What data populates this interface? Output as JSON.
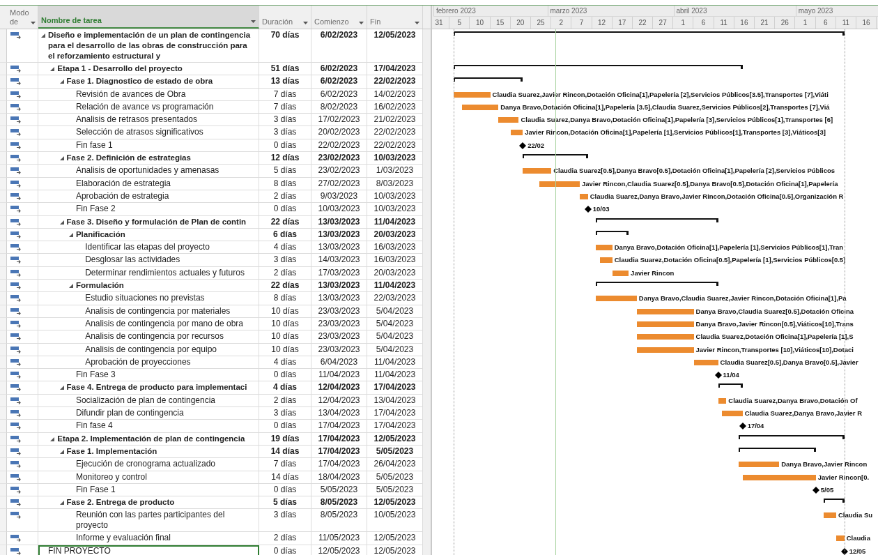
{
  "columns": [
    {
      "label": "Modo de",
      "selected": false
    },
    {
      "label": "Nombre de tarea",
      "selected": true
    },
    {
      "label": "Duración",
      "selected": false
    },
    {
      "label": "Comienzo",
      "selected": false
    },
    {
      "label": "Fin",
      "selected": false
    }
  ],
  "timescale": {
    "months": [
      "febrero 2023",
      "marzo 2023",
      "abril 2023",
      "mayo 2023"
    ],
    "days": [
      "31",
      "5",
      "10",
      "15",
      "20",
      "25",
      "2",
      "7",
      "12",
      "17",
      "22",
      "27",
      "1",
      "6",
      "11",
      "16",
      "21",
      "26",
      "1",
      "6",
      "11",
      "16"
    ]
  },
  "tasks": [
    {
      "name": "Diseño e implementación de un plan de contingencia para el desarrollo de las obras de construcción para el reforzamiento estructural y",
      "duration": "70 días",
      "start": "6/02/2023",
      "finish": "12/05/2023",
      "kind": "summary",
      "expanded": true,
      "selected": false,
      "children": [
        {
          "name": "Etapa 1 - Desarrollo del proyecto",
          "duration": "51 días",
          "start": "6/02/2023",
          "finish": "17/04/2023",
          "kind": "summary",
          "expanded": true,
          "selected": false,
          "children": [
            {
              "name": "Fase 1. Diagnostico de estado de obra",
              "duration": "13 días",
              "start": "6/02/2023",
              "finish": "22/02/2023",
              "kind": "summary",
              "expanded": true,
              "selected": false,
              "children": [
                {
                  "name": "Revisión de avances de Obra",
                  "duration": "7 días",
                  "start": "6/02/2023",
                  "finish": "14/02/2023",
                  "kind": "task",
                  "selected": false,
                  "label": "Claudia Suarez,Javier Rincon,Dotación Oficina[1],Papelería [2],Servicios Públicos[3.5],Transportes [7],Viáti"
                },
                {
                  "name": "Relación de avance vs programación",
                  "duration": "7 días",
                  "start": "8/02/2023",
                  "finish": "16/02/2023",
                  "kind": "task",
                  "selected": false,
                  "label": "Danya Bravo,Dotación Oficina[1],Papelería [3.5],Claudia Suarez,Servicios Públicos[2],Transportes [7],Viá"
                },
                {
                  "name": "Analisis de retrasos presentados",
                  "duration": "3 días",
                  "start": "17/02/2023",
                  "finish": "21/02/2023",
                  "kind": "task",
                  "selected": false,
                  "label": "Claudia Suarez,Danya Bravo,Dotación Oficina[1],Papelería [3],Servicios Públicos[1],Transportes [6]"
                },
                {
                  "name": "Selección de atrasos significativos",
                  "duration": "3 días",
                  "start": "20/02/2023",
                  "finish": "22/02/2023",
                  "kind": "task",
                  "selected": false,
                  "label": "Javier Rincon,Dotación Oficina[1],Papelería [1],Servicios Públicos[1],Transportes [3],Viáticos[3]"
                },
                {
                  "name": "Fin fase 1",
                  "duration": "0 días",
                  "start": "22/02/2023",
                  "finish": "22/02/2023",
                  "kind": "milestone",
                  "selected": false,
                  "label": "22/02"
                }
              ]
            },
            {
              "name": "Fase 2. Definición de estrategias",
              "duration": "12 días",
              "start": "23/02/2023",
              "finish": "10/03/2023",
              "kind": "summary",
              "expanded": true,
              "selected": false,
              "children": [
                {
                  "name": "Analisis de oportunidades y amenasas",
                  "duration": "5 días",
                  "start": "23/02/2023",
                  "finish": "1/03/2023",
                  "kind": "task",
                  "selected": false,
                  "label": "Claudia Suarez[0.5],Danya Bravo[0.5],Dotación Oficina[1],Papelería [2],Servicios Públicos"
                },
                {
                  "name": "Elaboración de estrategia",
                  "duration": "8 días",
                  "start": "27/02/2023",
                  "finish": "8/03/2023",
                  "kind": "task",
                  "selected": false,
                  "label": "Javier Rincon,Claudia Suarez[0.5],Danya Bravo[0.5],Dotación Oficina[1],Papelería"
                },
                {
                  "name": "Aprobación de estrategia",
                  "duration": "2 días",
                  "start": "9/03/2023",
                  "finish": "10/03/2023",
                  "kind": "task",
                  "selected": false,
                  "label": "Claudia Suarez,Danya Bravo,Javier Rincon,Dotación Oficina[0.5],Organización R"
                },
                {
                  "name": "Fin Fase 2",
                  "duration": "0 días",
                  "start": "10/03/2023",
                  "finish": "10/03/2023",
                  "kind": "milestone",
                  "selected": false,
                  "label": "10/03"
                }
              ]
            },
            {
              "name": "Fase 3. Diseño y formulación de Plan de contin",
              "duration": "22 días",
              "start": "13/03/2023",
              "finish": "11/04/2023",
              "kind": "summary",
              "expanded": true,
              "selected": false,
              "children": [
                {
                  "name": "Planificación",
                  "duration": "6 días",
                  "start": "13/03/2023",
                  "finish": "20/03/2023",
                  "kind": "summary",
                  "expanded": true,
                  "selected": false,
                  "children": [
                    {
                      "name": "Identificar las etapas del proyecto",
                      "duration": "4 días",
                      "start": "13/03/2023",
                      "finish": "16/03/2023",
                      "kind": "task",
                      "selected": false,
                      "label": "Danya Bravo,Dotación Oficina[1],Papelería [1],Servicios Públicos[1],Tran"
                    },
                    {
                      "name": "Desglosar las actividades",
                      "duration": "3 días",
                      "start": "14/03/2023",
                      "finish": "16/03/2023",
                      "kind": "task",
                      "selected": false,
                      "label": "Claudia Suarez,Dotación Oficina[0.5],Papelería [1],Servicios Públicos[0.5]"
                    },
                    {
                      "name": "Determinar rendimientos actuales y futuros",
                      "duration": "2 días",
                      "start": "17/03/2023",
                      "finish": "20/03/2023",
                      "kind": "task",
                      "selected": false,
                      "label": "Javier Rincon"
                    }
                  ]
                },
                {
                  "name": "Formulación",
                  "duration": "22 días",
                  "start": "13/03/2023",
                  "finish": "11/04/2023",
                  "kind": "summary",
                  "expanded": true,
                  "selected": false,
                  "children": [
                    {
                      "name": "Estudio situaciones no previstas",
                      "duration": "8 días",
                      "start": "13/03/2023",
                      "finish": "22/03/2023",
                      "kind": "task",
                      "selected": false,
                      "label": "Danya Bravo,Claudia Suarez,Javier Rincon,Dotación Oficina[1],Pa"
                    },
                    {
                      "name": "Analisis de contingencia por materiales",
                      "duration": "10 días",
                      "start": "23/03/2023",
                      "finish": "5/04/2023",
                      "kind": "task",
                      "selected": false,
                      "label": "Danya Bravo,Claudia Suarez[0.5],Dotación Oficina"
                    },
                    {
                      "name": "Analisis de contingencia por mano de obra",
                      "duration": "10 días",
                      "start": "23/03/2023",
                      "finish": "5/04/2023",
                      "kind": "task",
                      "selected": false,
                      "label": "Danya Bravo,Javier Rincon[0.5],Viáticos[10],Trans"
                    },
                    {
                      "name": "Analisis de contingencia por recursos",
                      "duration": "10 días",
                      "start": "23/03/2023",
                      "finish": "5/04/2023",
                      "kind": "task",
                      "selected": false,
                      "label": "Claudia Suarez,Dotación Oficina[1],Papelería [1],S"
                    },
                    {
                      "name": "Analisis de contingencia por equipo",
                      "duration": "10 días",
                      "start": "23/03/2023",
                      "finish": "5/04/2023",
                      "kind": "task",
                      "selected": false,
                      "label": "Javier Rincon,Transportes [10],Viáticos[10],Dotaci"
                    },
                    {
                      "name": "Aprobación de proyecciones",
                      "duration": "4 días",
                      "start": "6/04/2023",
                      "finish": "11/04/2023",
                      "kind": "task",
                      "selected": false,
                      "label": "Claudia Suarez[0.5],Danya Bravo[0.5],Javier"
                    }
                  ]
                },
                {
                  "name": "Fin Fase 3",
                  "duration": "0 días",
                  "start": "11/04/2023",
                  "finish": "11/04/2023",
                  "kind": "milestone",
                  "selected": false,
                  "label": "11/04"
                }
              ]
            },
            {
              "name": "Fase 4. Entrega de producto para implementaci",
              "duration": "4 días",
              "start": "12/04/2023",
              "finish": "17/04/2023",
              "kind": "summary",
              "expanded": true,
              "selected": false,
              "children": [
                {
                  "name": "Socialización de plan de contingencia",
                  "duration": "2 días",
                  "start": "12/04/2023",
                  "finish": "13/04/2023",
                  "kind": "task",
                  "selected": false,
                  "label": "Claudia Suarez,Danya Bravo,Dotación Of"
                },
                {
                  "name": "Difundir plan de contingencia",
                  "duration": "3 días",
                  "start": "13/04/2023",
                  "finish": "17/04/2023",
                  "kind": "task",
                  "selected": false,
                  "label": "Claudia Suarez,Danya Bravo,Javier R"
                },
                {
                  "name": "Fin fase 4",
                  "duration": "0 días",
                  "start": "17/04/2023",
                  "finish": "17/04/2023",
                  "kind": "milestone",
                  "selected": false,
                  "label": "17/04"
                }
              ]
            }
          ]
        },
        {
          "name": "Etapa 2. Implementación de plan de contingencia",
          "duration": "19 días",
          "start": "17/04/2023",
          "finish": "12/05/2023",
          "kind": "summary",
          "expanded": true,
          "selected": false,
          "children": [
            {
              "name": "Fase 1. Implementación",
              "duration": "14 días",
              "start": "17/04/2023",
              "finish": "5/05/2023",
              "kind": "summary",
              "expanded": true,
              "selected": false,
              "children": [
                {
                  "name": "Ejecución de cronograma actualizado",
                  "duration": "7 días",
                  "start": "17/04/2023",
                  "finish": "26/04/2023",
                  "kind": "task",
                  "selected": false,
                  "label": "Danya Bravo,Javier Rincon"
                },
                {
                  "name": "Monitoreo y control",
                  "duration": "14 días",
                  "start": "18/04/2023",
                  "finish": "5/05/2023",
                  "kind": "task",
                  "selected": false,
                  "label": "Javier Rincon[0."
                },
                {
                  "name": "Fin Fase 1",
                  "duration": "0 días",
                  "start": "5/05/2023",
                  "finish": "5/05/2023",
                  "kind": "milestone",
                  "selected": false,
                  "label": "5/05"
                }
              ]
            },
            {
              "name": "Fase 2. Entrega de producto",
              "duration": "5 días",
              "start": "8/05/2023",
              "finish": "12/05/2023",
              "kind": "summary",
              "expanded": true,
              "selected": false,
              "children": [
                {
                  "name": "Reunión con las partes participantes del proyecto",
                  "duration": "3 días",
                  "start": "8/05/2023",
                  "finish": "10/05/2023",
                  "kind": "task",
                  "selected": false,
                  "label": "Claudia Su"
                },
                {
                  "name": "Informe y evaluación final",
                  "duration": "2 días",
                  "start": "11/05/2023",
                  "finish": "12/05/2023",
                  "kind": "task",
                  "selected": false,
                  "label": "Claudia"
                }
              ]
            }
          ]
        }
      ]
    },
    {
      "name": "FIN PROYECTO",
      "duration": "0 días",
      "start": "12/05/2023",
      "finish": "12/05/2023",
      "kind": "milestone",
      "selected": true,
      "label": "12/05"
    }
  ]
}
